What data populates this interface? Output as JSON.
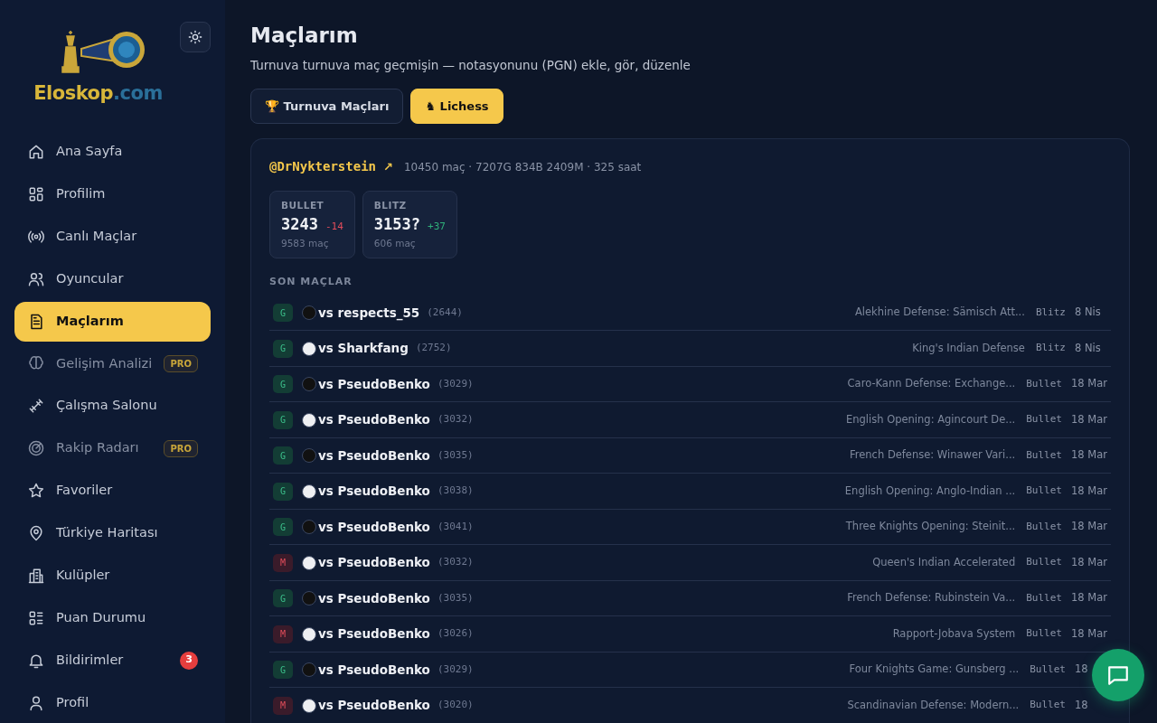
{
  "brand": {
    "name": "Eloskop",
    "suffix": ".com"
  },
  "sidebar": {
    "items": [
      {
        "label": "Ana Sayfa",
        "selected": false,
        "disabled": false
      },
      {
        "label": "Profilim",
        "selected": false,
        "disabled": false
      },
      {
        "label": "Canlı Maçlar",
        "selected": false,
        "disabled": false
      },
      {
        "label": "Oyuncular",
        "selected": false,
        "disabled": false
      },
      {
        "label": "Maçlarım",
        "selected": true,
        "disabled": false
      },
      {
        "label": "Gelişim Analizi",
        "selected": false,
        "disabled": true,
        "tag": "PRO"
      },
      {
        "label": "Çalışma Salonu",
        "selected": false,
        "disabled": false
      },
      {
        "label": "Rakip Radarı",
        "selected": false,
        "disabled": true,
        "tag": "PRO"
      },
      {
        "label": "Favoriler",
        "selected": false,
        "disabled": false
      },
      {
        "label": "Türkiye Haritası",
        "selected": false,
        "disabled": false
      },
      {
        "label": "Kulüpler",
        "selected": false,
        "disabled": false
      },
      {
        "label": "Puan Durumu",
        "selected": false,
        "disabled": false
      },
      {
        "label": "Bildirimler",
        "selected": false,
        "disabled": false,
        "count": "3"
      },
      {
        "label": "Profil",
        "selected": false,
        "disabled": false
      }
    ]
  },
  "page": {
    "title": "Maçlarım",
    "subtitle": "Turnuva turnuva maç geçmişin — notasyonunu (PGN) ekle, gör, düzenle"
  },
  "tabs": [
    {
      "label": "🏆 Turnuva Maçları",
      "selected": false
    },
    {
      "label": "♞ Lichess",
      "selected": true
    }
  ],
  "profile": {
    "handle": "@DrNykterstein",
    "link": "↗",
    "summary": "10450 maç · 7207G 834B 2409M · 325 saat",
    "ratings": [
      {
        "label": "BULLET",
        "rating": "3243",
        "delta": "-14",
        "color": "#e04c5a",
        "games": "9583 maç"
      },
      {
        "label": "BLITZ",
        "rating": "3153?",
        "delta": "+37",
        "color": "#2fb07a",
        "games": "606 maç"
      }
    ]
  },
  "recent": {
    "heading": "SON MAÇLAR",
    "games": [
      {
        "result": "G",
        "color": "#111111",
        "opponent": "vs respects_55",
        "rating": "(2644)",
        "opening": "Alekhine Defense: Sämisch Att...",
        "speed": "Blitz",
        "date": "8 Nis"
      },
      {
        "result": "G",
        "color": "#eeeff2",
        "opponent": "vs Sharkfang",
        "rating": "(2752)",
        "opening": "King's Indian Defense",
        "speed": "Blitz",
        "date": "8 Nis"
      },
      {
        "result": "G",
        "color": "#111111",
        "opponent": "vs PseudoBenko",
        "rating": "(3029)",
        "opening": "Caro-Kann Defense: Exchange...",
        "speed": "Bullet",
        "date": "18 Mar"
      },
      {
        "result": "G",
        "color": "#eeeff2",
        "opponent": "vs PseudoBenko",
        "rating": "(3032)",
        "opening": "English Opening: Agincourt De...",
        "speed": "Bullet",
        "date": "18 Mar"
      },
      {
        "result": "G",
        "color": "#111111",
        "opponent": "vs PseudoBenko",
        "rating": "(3035)",
        "opening": "French Defense: Winawer Vari...",
        "speed": "Bullet",
        "date": "18 Mar"
      },
      {
        "result": "G",
        "color": "#eeeff2",
        "opponent": "vs PseudoBenko",
        "rating": "(3038)",
        "opening": "English Opening: Anglo-Indian ...",
        "speed": "Bullet",
        "date": "18 Mar"
      },
      {
        "result": "G",
        "color": "#111111",
        "opponent": "vs PseudoBenko",
        "rating": "(3041)",
        "opening": "Three Knights Opening: Steinit...",
        "speed": "Bullet",
        "date": "18 Mar"
      },
      {
        "result": "M",
        "color": "#eeeff2",
        "opponent": "vs PseudoBenko",
        "rating": "(3032)",
        "opening": "Queen's Indian Accelerated",
        "speed": "Bullet",
        "date": "18 Mar"
      },
      {
        "result": "G",
        "color": "#111111",
        "opponent": "vs PseudoBenko",
        "rating": "(3035)",
        "opening": "French Defense: Rubinstein Va...",
        "speed": "Bullet",
        "date": "18 Mar"
      },
      {
        "result": "M",
        "color": "#eeeff2",
        "opponent": "vs PseudoBenko",
        "rating": "(3026)",
        "opening": "Rapport-Jobava System",
        "speed": "Bullet",
        "date": "18 Mar"
      },
      {
        "result": "G",
        "color": "#111111",
        "opponent": "vs PseudoBenko",
        "rating": "(3029)",
        "opening": "Four Knights Game: Gunsberg ...",
        "speed": "Bullet",
        "date": "18"
      },
      {
        "result": "M",
        "color": "#eeeff2",
        "opponent": "vs PseudoBenko",
        "rating": "(3020)",
        "opening": "Scandinavian Defense: Modern...",
        "speed": "Bullet",
        "date": "18"
      }
    ]
  }
}
